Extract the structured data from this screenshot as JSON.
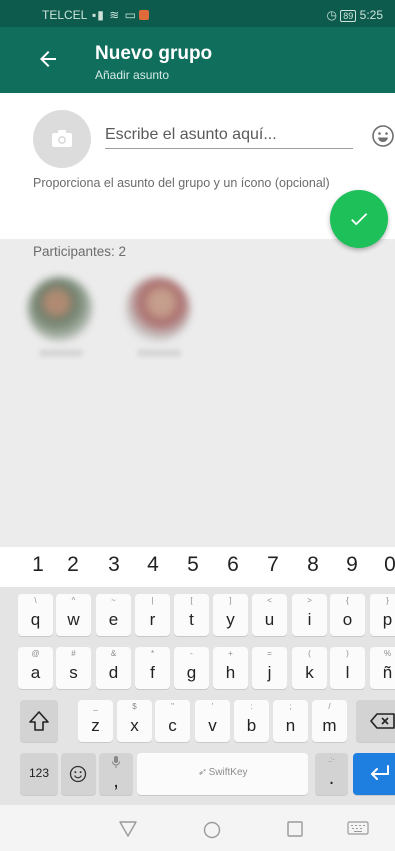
{
  "status_bar": {
    "carrier": "TELCEL",
    "battery": "89",
    "time": "5:25"
  },
  "app_bar": {
    "title": "Nuevo grupo",
    "subtitle": "Añadir asunto"
  },
  "subject": {
    "placeholder": "Escribe el asunto aquí...",
    "hint": "Proporciona el asunto del grupo y un ícono (opcional)"
  },
  "participants": {
    "label": "Participantes: 2",
    "count": 2
  },
  "keyboard": {
    "numbers": [
      "1",
      "2",
      "3",
      "4",
      "5",
      "6",
      "7",
      "8",
      "9",
      "0"
    ],
    "row1": [
      {
        "main": "q",
        "sub": "\\"
      },
      {
        "main": "w",
        "sub": "^"
      },
      {
        "main": "e",
        "sub": "~"
      },
      {
        "main": "r",
        "sub": "|"
      },
      {
        "main": "t",
        "sub": "["
      },
      {
        "main": "y",
        "sub": "]"
      },
      {
        "main": "u",
        "sub": "<"
      },
      {
        "main": "i",
        "sub": ">"
      },
      {
        "main": "o",
        "sub": "{"
      },
      {
        "main": "p",
        "sub": "}"
      }
    ],
    "row2": [
      {
        "main": "a",
        "sub": "@"
      },
      {
        "main": "s",
        "sub": "#"
      },
      {
        "main": "d",
        "sub": "&"
      },
      {
        "main": "f",
        "sub": "*"
      },
      {
        "main": "g",
        "sub": "-"
      },
      {
        "main": "h",
        "sub": "+"
      },
      {
        "main": "j",
        "sub": "="
      },
      {
        "main": "k",
        "sub": "("
      },
      {
        "main": "l",
        "sub": ")"
      },
      {
        "main": "ñ",
        "sub": "%"
      }
    ],
    "row3": [
      {
        "main": "z",
        "sub": "_"
      },
      {
        "main": "x",
        "sub": "$"
      },
      {
        "main": "c",
        "sub": "\""
      },
      {
        "main": "v",
        "sub": "'"
      },
      {
        "main": "b",
        "sub": ":"
      },
      {
        "main": "n",
        "sub": ";"
      },
      {
        "main": "m",
        "sub": "/"
      }
    ],
    "symbols_label": "123",
    "comma": ",",
    "period": ".",
    "space_label": "SwiftKey"
  },
  "colors": {
    "status_bar": "#0c5b4c",
    "app_bar": "#0f6e5c",
    "fab": "#1ec05a",
    "enter_key": "#1f7fe0"
  }
}
